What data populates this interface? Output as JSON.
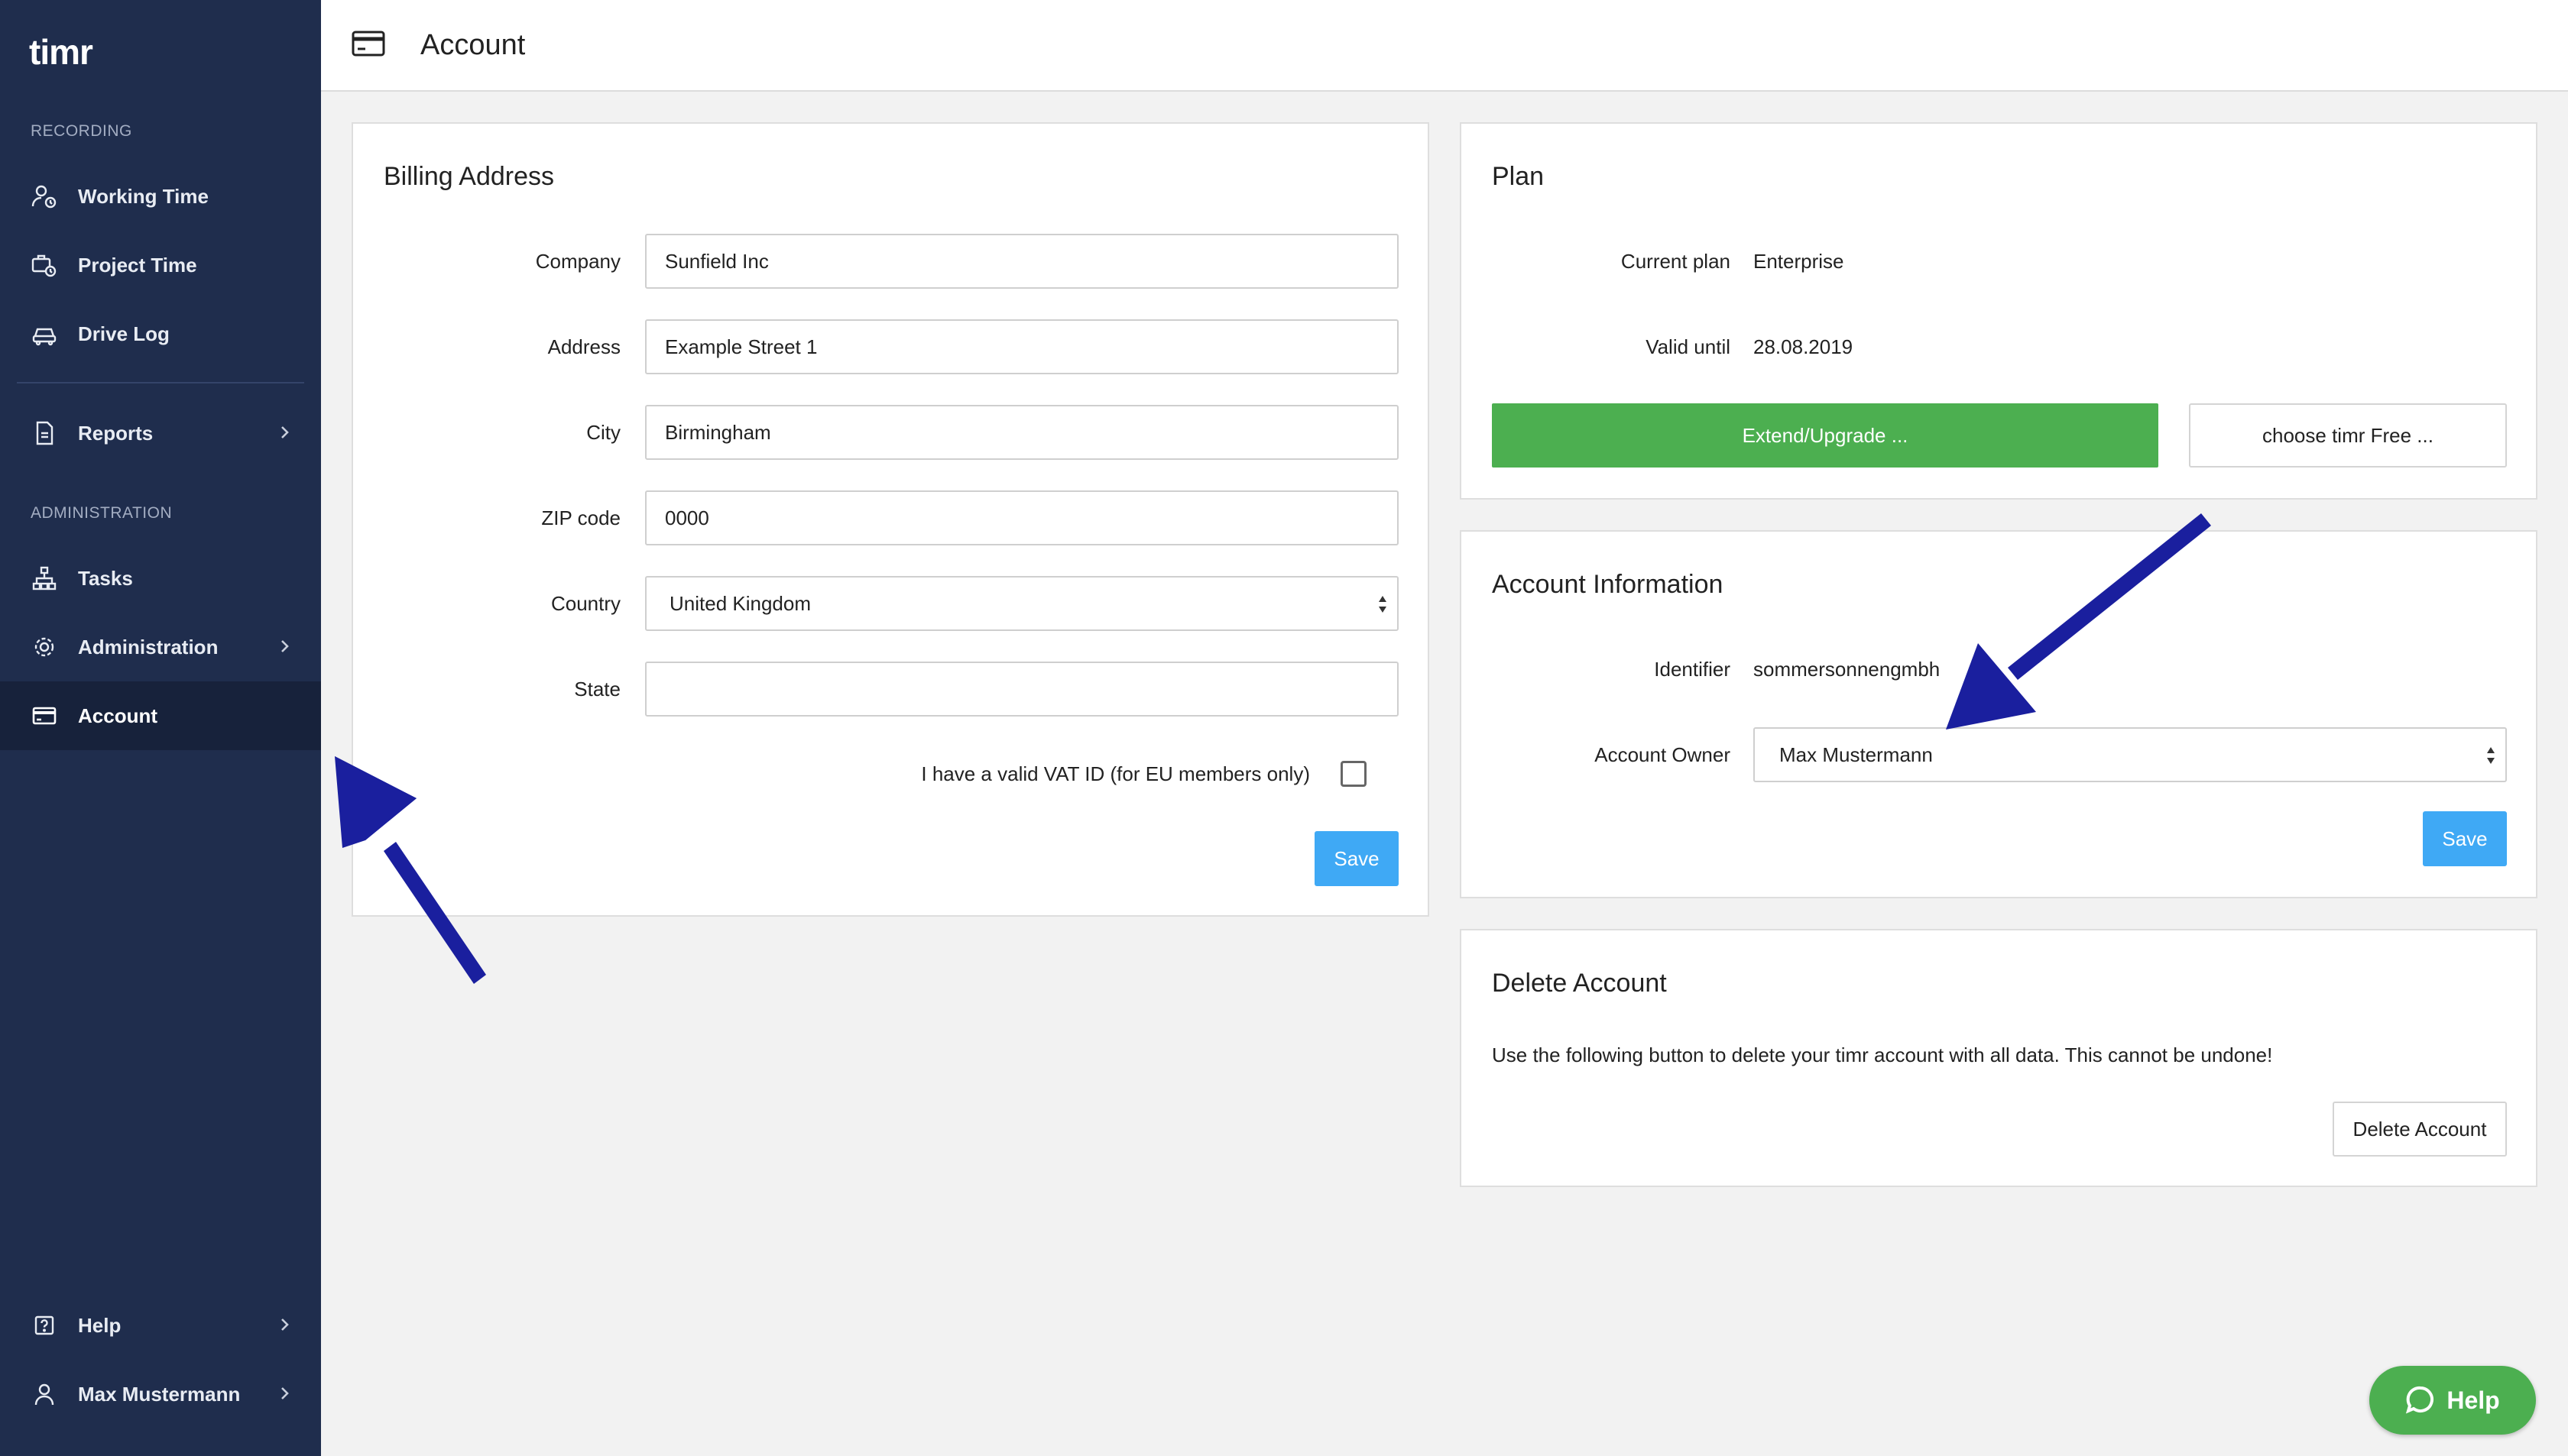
{
  "app": {
    "logo_text": "timr"
  },
  "colors": {
    "sidebar_bg": "#1f2d4d",
    "accent_blue": "#3fa9f5",
    "accent_green": "#4caf50",
    "annotation_arrow": "#1a1f9e"
  },
  "sidebar": {
    "section_recording": "RECORDING",
    "section_administration": "ADMINISTRATION",
    "items": {
      "working_time": "Working Time",
      "project_time": "Project Time",
      "drive_log": "Drive Log",
      "reports": "Reports",
      "tasks": "Tasks",
      "administration": "Administration",
      "account": "Account",
      "help": "Help",
      "user": "Max Mustermann"
    },
    "active_item": "account"
  },
  "header": {
    "title": "Account",
    "icon": "credit-card-icon"
  },
  "billing": {
    "title": "Billing Address",
    "company_label": "Company",
    "company_value": "Sunfield Inc",
    "address_label": "Address",
    "address_value": "Example Street 1",
    "city_label": "City",
    "city_value": "Birmingham",
    "zip_label": "ZIP code",
    "zip_value": "0000",
    "country_label": "Country",
    "country_value": "United Kingdom",
    "state_label": "State",
    "state_value": "",
    "vat_label": "I have a valid VAT ID (for EU members only)",
    "vat_checked": false,
    "save_label": "Save"
  },
  "plan": {
    "title": "Plan",
    "current_plan_label": "Current plan",
    "current_plan_value": "Enterprise",
    "valid_until_label": "Valid until",
    "valid_until_value": "28.08.2019",
    "extend_label": "Extend/Upgrade ...",
    "free_label": "choose timr Free ..."
  },
  "account_info": {
    "title": "Account Information",
    "identifier_label": "Identifier",
    "identifier_value": "sommersonnengmbh",
    "owner_label": "Account Owner",
    "owner_value": "Max Mustermann",
    "save_label": "Save"
  },
  "delete": {
    "title": "Delete Account",
    "description": "Use the following button to delete your timr account with all data. This cannot be undone!",
    "button_label": "Delete Account"
  },
  "help_fab": {
    "label": "Help"
  }
}
